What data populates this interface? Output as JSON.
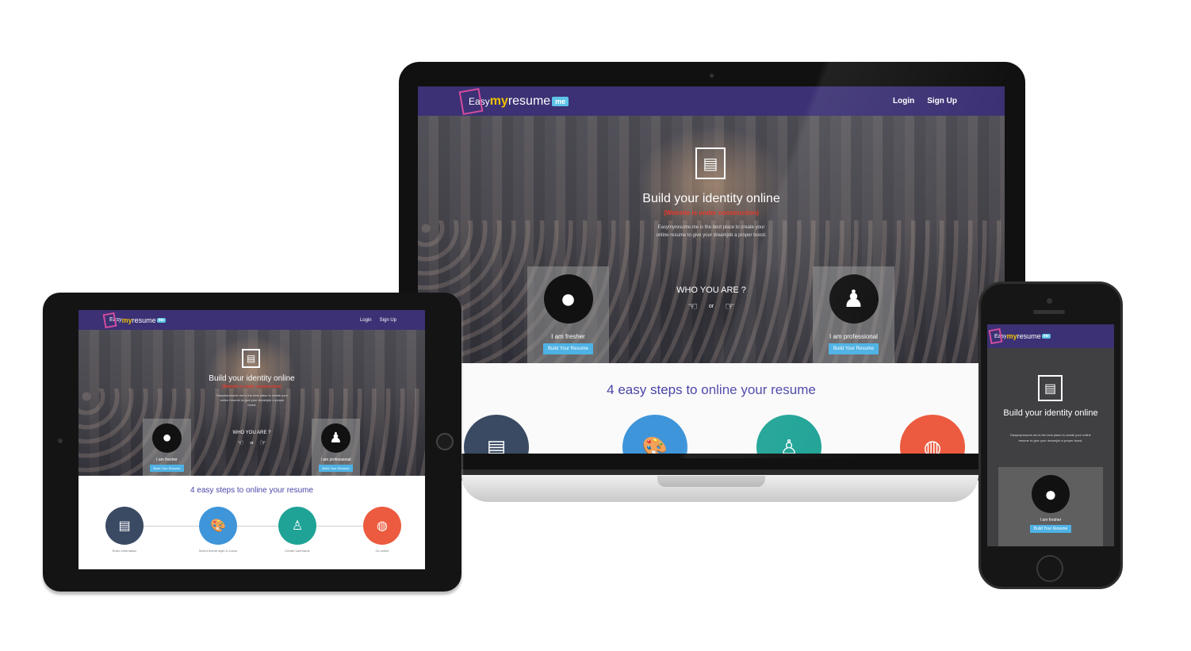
{
  "site": {
    "logo": {
      "pre": "Easy",
      "my": "my",
      "resume": "resume",
      "badge": "me"
    },
    "nav": {
      "login": "Login",
      "signup": "Sign Up"
    },
    "hero": {
      "title": "Build your identity online",
      "subtitle": "(Website is under construction)",
      "description": "Easymyresume.me is the best place to create your online resume to give your dreamjob a proper boost.",
      "who_title": "WHO YOU ARE ?",
      "or": "or",
      "fresher_label": "I am fresher",
      "professional_label": "I am professional",
      "button_label": "Build Your Resume"
    },
    "steps": {
      "title": "4 easy steps to online your resume",
      "captions": [
        "Enter Information",
        "Select theme style & colour",
        "Create Username",
        "Go online"
      ]
    }
  },
  "colors": {
    "nav": "#3b3174",
    "button": "#4eb2e4",
    "accent_text": "#4a44a8",
    "subtitle": "#e8392c",
    "step_colors": [
      "#3a4a63",
      "#3f95d9",
      "#1fa396",
      "#ec5b3f"
    ]
  },
  "icons": [
    "resume-card-icon",
    "user-silhouette-icon",
    "professional-user-icon",
    "thumb-icon",
    "palette-icon",
    "user-outline-icon",
    "globe-icon"
  ]
}
